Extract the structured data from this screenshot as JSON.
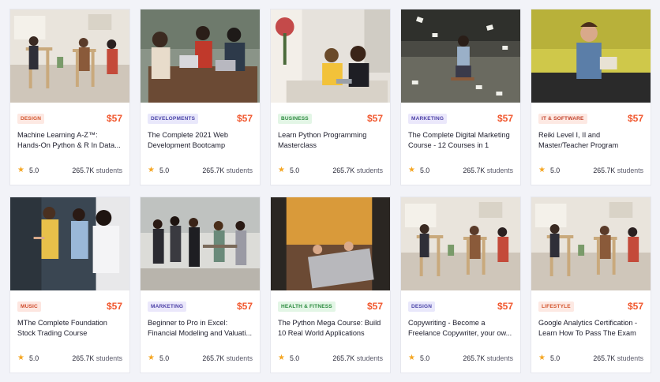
{
  "colors": {
    "price": "#f1582f",
    "star": "#f5a623",
    "page_bg": "#f2f3f8"
  },
  "courses": [
    {
      "category": "Design",
      "price": "$57",
      "title": "Machine Learning A-Z™: Hands-On Python & R In Data...",
      "rating": "5.0",
      "students_count": "265.7K",
      "students_label": "students",
      "badge_bg": "#fde9e3",
      "badge_fg": "#d2532b",
      "image": "classroom"
    },
    {
      "category": "Developments",
      "price": "$57",
      "title": "The Complete 2021 Web Development Bootcamp",
      "rating": "5.0",
      "students_count": "265.7K",
      "students_label": "students",
      "badge_bg": "#e9e8fb",
      "badge_fg": "#4a44a8",
      "image": "team-laptop"
    },
    {
      "category": "Business",
      "price": "$57",
      "title": "Learn Python Programming Masterclass",
      "rating": "5.0",
      "students_count": "265.7K",
      "students_label": "students",
      "badge_bg": "#e3f6e6",
      "badge_fg": "#2b8a3e",
      "image": "pair-study"
    },
    {
      "category": "Marketing",
      "price": "$57",
      "title": "The Complete Digital Marketing Course - 12 Courses in 1",
      "rating": "5.0",
      "students_count": "265.7K",
      "students_label": "students",
      "badge_bg": "#ebe8fb",
      "badge_fg": "#4b3fa6",
      "image": "papers-road"
    },
    {
      "category": "IT & Software",
      "price": "$57",
      "title": "Reiki Level I, II and Master/Teacher Program",
      "rating": "5.0",
      "students_count": "265.7K",
      "students_label": "students",
      "badge_bg": "#fde9e3",
      "badge_fg": "#c2412a",
      "image": "man-couch"
    },
    {
      "category": "Music",
      "price": "$57",
      "title": "MThe Complete Foundation Stock Trading Course",
      "rating": "5.0",
      "students_count": "265.7K",
      "students_label": "students",
      "badge_bg": "#fde6e0",
      "badge_fg": "#cf4b2c",
      "image": "whiteboard"
    },
    {
      "category": "Marketing",
      "price": "$57",
      "title": "Beginner to Pro in Excel: Financial Modeling and Valuati...",
      "rating": "5.0",
      "students_count": "265.7K",
      "students_label": "students",
      "badge_bg": "#ebe8fb",
      "badge_fg": "#4b3fa6",
      "image": "group-standing"
    },
    {
      "category": "Health & Fitness",
      "price": "$57",
      "title": "The Python Mega Course: Build 10 Real World Applications",
      "rating": "5.0",
      "students_count": "265.7K",
      "students_label": "students",
      "badge_bg": "#e3f6e6",
      "badge_fg": "#2b8a3e",
      "image": "laptop-closeup"
    },
    {
      "category": "Design",
      "price": "$57",
      "title": "Copywriting - Become a Freelance Copywriter, your ow...",
      "rating": "5.0",
      "students_count": "265.7K",
      "students_label": "students",
      "badge_bg": "#e9e8fb",
      "badge_fg": "#4a44a8",
      "image": "classroom"
    },
    {
      "category": "Lifestyle",
      "price": "$57",
      "title": "Google Analytics Certification - Learn How To Pass The Exam",
      "rating": "5.0",
      "students_count": "265.7K",
      "students_label": "students",
      "badge_bg": "#fde9e3",
      "badge_fg": "#d2532b",
      "image": "classroom"
    }
  ]
}
